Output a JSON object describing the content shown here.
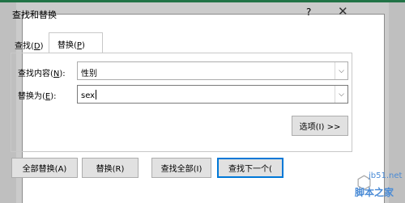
{
  "dialog": {
    "title": "查找和替换",
    "help": "?",
    "close": "✕"
  },
  "tabs": [
    {
      "text": "查找(",
      "key": "D",
      "end": ")"
    },
    {
      "text": "替换(",
      "key": "P",
      "end": ")"
    }
  ],
  "fields": {
    "find_label": "查找内容(",
    "find_key": "N",
    "find_end": "):",
    "find_value": "性别",
    "replace_label": "替换为(",
    "replace_key": "E",
    "replace_end": "):",
    "replace_value": "sex"
  },
  "buttons": {
    "options": "选项(I) >>",
    "replace_all": "全部替换(A)",
    "replace": "替换(R)",
    "find_all": "查找全部(I)",
    "find_next": "查找下一个("
  },
  "watermark": {
    "url": "jb51.net",
    "name": "脚本之家"
  }
}
